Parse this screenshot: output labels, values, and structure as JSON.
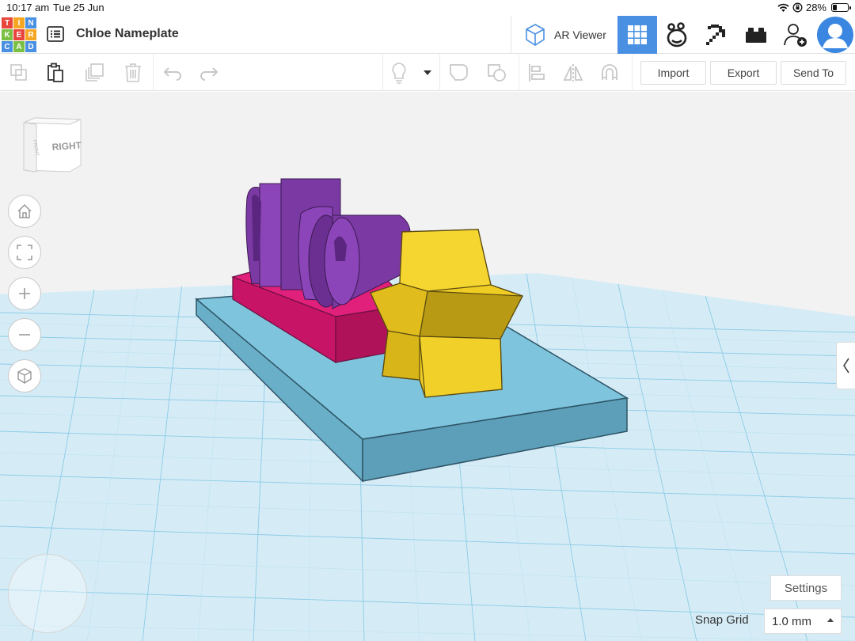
{
  "status": {
    "time": "10:17 am",
    "date": "Tue 25 Jun",
    "battery": "28%",
    "battery_level": 0.28
  },
  "logo": {
    "letters": [
      "T",
      "I",
      "N",
      "K",
      "E",
      "R",
      "C",
      "A",
      "D"
    ],
    "colors": [
      "#e8453c",
      "#f5a623",
      "#4a90e2",
      "#7bc043",
      "#e8453c",
      "#f5a623",
      "#4a90e2",
      "#7bc043",
      "#4a90e2"
    ]
  },
  "header": {
    "title": "Chloe Nameplate",
    "ar_viewer": "AR Viewer",
    "icons": [
      "grid-view-icon",
      "bear-icon",
      "pickaxe-icon",
      "brick-icon",
      "add-user-icon",
      "user-avatar-icon"
    ]
  },
  "toolbar": {
    "import": "Import",
    "export": "Export",
    "send_to": "Send To"
  },
  "viewcube": {
    "front": "FRONT",
    "right": "RIGHT"
  },
  "settings": {
    "label": "Settings"
  },
  "snap": {
    "label": "Snap Grid",
    "value": "1.0 mm"
  },
  "colors": {
    "accent": "#4a90e2",
    "grid": "#86c9e6",
    "base": "#7ec4dd",
    "pink": "#e0207a",
    "purple": "#7b3aa3",
    "star": "#f0cd22"
  }
}
